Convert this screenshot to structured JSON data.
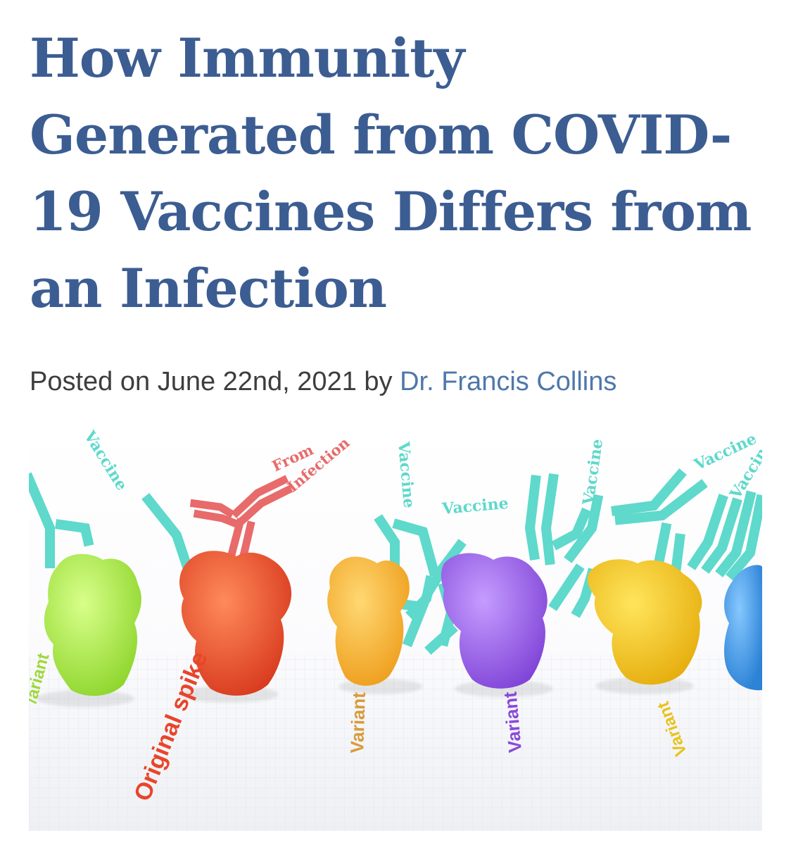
{
  "article": {
    "title": "How Immunity Generated from COVID-19 Vaccines Differs from an Infection",
    "byline": {
      "prefix": "Posted on June 22nd, 2021 by",
      "author": "Dr. Francis Collins"
    }
  },
  "illustration": {
    "antibody_labels": {
      "vaccine": "Vaccine",
      "from": "From",
      "infection": "Infection"
    },
    "floor_labels": {
      "variant": "Variant",
      "variant_partial": "/ariant",
      "original_spike": "Original spike"
    },
    "colors": {
      "title": "#3c5d92",
      "author_link": "#4f77ab",
      "vaccine_antibody": "#5ed9cb",
      "infection_antibody": "#e86a6a",
      "spike_green": "#a9e84a",
      "spike_red": "#e8452a",
      "spike_orange": "#f3b22f",
      "spike_purple": "#9a63e6",
      "spike_yellow": "#f0c51e",
      "spike_blue": "#3f9be6"
    }
  }
}
